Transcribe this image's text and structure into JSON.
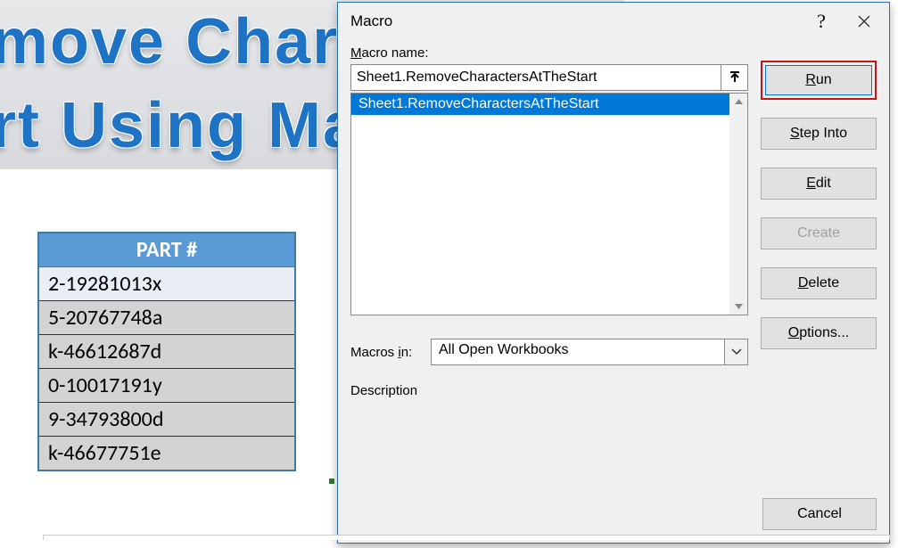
{
  "banner": {
    "line1": "move Chara",
    "line2": "rt Using Ma"
  },
  "table": {
    "header": "PART #",
    "rows": [
      "2-19281013x",
      "5-20767748a",
      "k-46612687d",
      "0-10017191y",
      "9-34793800d",
      "k-46677751e"
    ]
  },
  "dialog": {
    "title": "Macro",
    "label_macro_name_pre": "M",
    "label_macro_name_post": "acro name:",
    "macro_name_value": "Sheet1.RemoveCharactersAtTheStart",
    "list": [
      "Sheet1.RemoveCharactersAtTheStart"
    ],
    "label_macros_in_pre": "Macros ",
    "label_macros_in_accel": "i",
    "label_macros_in_post": "n:",
    "macros_in_value": "All Open Workbooks",
    "desc_pre": "Descr",
    "desc_accel": "i",
    "desc_post": "ption",
    "buttons": {
      "run_pre": "",
      "run_accel": "R",
      "run_post": "un",
      "step_pre": "",
      "step_accel": "S",
      "step_post": "tep Into",
      "edit_pre": "",
      "edit_accel": "E",
      "edit_post": "dit",
      "create": "Create",
      "delete_pre": "",
      "delete_accel": "D",
      "delete_post": "elete",
      "options_pre": "",
      "options_accel": "O",
      "options_post": "ptions...",
      "cancel": "Cancel"
    }
  }
}
